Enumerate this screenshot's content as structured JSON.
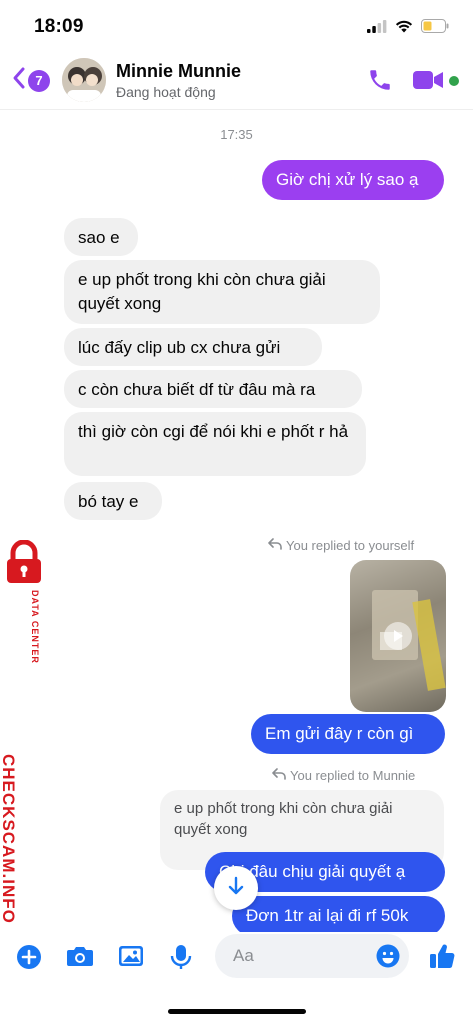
{
  "status_bar": {
    "time": "18:09"
  },
  "header": {
    "back_count": "7",
    "contact_name": "Minnie Munnie",
    "contact_status": "Đang hoạt động"
  },
  "chat": {
    "timestamp": "17:35",
    "messages": [
      {
        "text": "Giờ chị xử lý sao ạ"
      },
      {
        "text": "sao e"
      },
      {
        "text": "e up phốt trong khi còn chưa giải quyết xong"
      },
      {
        "text": "lúc đấy clip ub cx chưa gửi"
      },
      {
        "text": "c còn chưa biết df từ đâu mà ra"
      },
      {
        "text": "thì giờ còn cgi để nói khi e phốt r hả"
      },
      {
        "text": "bó tay e"
      },
      {
        "text": "Em gửi đây r còn gì"
      },
      {
        "text": "Chị đâu chịu giải quyết ạ"
      },
      {
        "text": "Đơn 1tr ai lại đi rf 50k"
      }
    ],
    "reply_note_1": "You replied to yourself",
    "reply_note_2": "You replied to Munnie",
    "quoted_text": "e up phốt trong khi còn chưa giải quyết xong"
  },
  "watermark": {
    "main": "CHECKSCAM.INFO",
    "sub": "DATA CENTER"
  },
  "composer": {
    "placeholder": "Aa"
  },
  "colors": {
    "accent_purple": "#9b3ff0",
    "accent_blue": "#2f55ee",
    "incoming_bubble": "#f0f0f0",
    "icon_blue": "#1877f2",
    "online": "#31a24c"
  }
}
